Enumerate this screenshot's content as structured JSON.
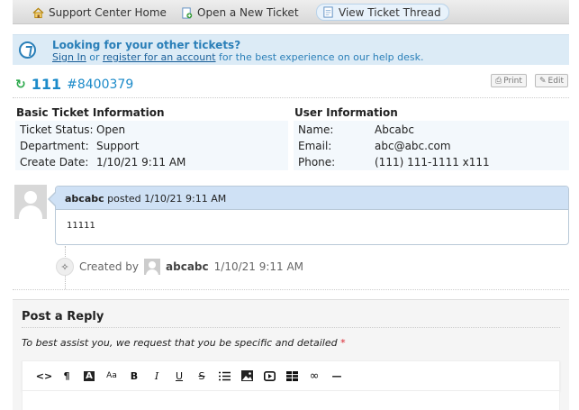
{
  "nav": {
    "items": [
      {
        "label": "Support Center Home",
        "icon": "home-icon"
      },
      {
        "label": "Open a New Ticket",
        "icon": "new-ticket-icon"
      },
      {
        "label": "View Ticket Thread",
        "icon": "ticket-thread-icon"
      }
    ]
  },
  "banner": {
    "title": "Looking for your other tickets?",
    "sign_in": "Sign In",
    "or": " or ",
    "register": "register for an account",
    "rest": " for the best experience on our help desk."
  },
  "ticket": {
    "number": "111",
    "ref": "#8400379",
    "print_label": "Print",
    "edit_label": "Edit"
  },
  "basic_info": {
    "heading": "Basic Ticket Information",
    "rows": [
      {
        "label": "Ticket Status:",
        "value": "Open"
      },
      {
        "label": "Department:",
        "value": "Support"
      },
      {
        "label": "Create Date:",
        "value": "1/10/21 9:11 AM"
      }
    ]
  },
  "user_info": {
    "heading": "User Information",
    "rows": [
      {
        "label": "Name:",
        "value": "Abcabc"
      },
      {
        "label": "Email:",
        "value": "abc@abc.com"
      },
      {
        "label": "Phone:",
        "value": "(111) 111-1111 x111"
      }
    ]
  },
  "thread": {
    "author": "abcabc",
    "posted_text": " posted 1/10/21 9:11 AM",
    "body": "11111",
    "event_prefix": "Created by",
    "event_author": "abcabc",
    "event_time": "1/10/21 9:11 AM"
  },
  "reply": {
    "title": "Post a Reply",
    "instruction": "To best assist you, we request that you be specific and detailed",
    "required_mark": "*",
    "toolbar": [
      "<>",
      "¶",
      "A",
      "Aa",
      "B",
      "I",
      "U",
      "S",
      "list",
      "image",
      "video",
      "table",
      "link",
      "hr"
    ]
  }
}
